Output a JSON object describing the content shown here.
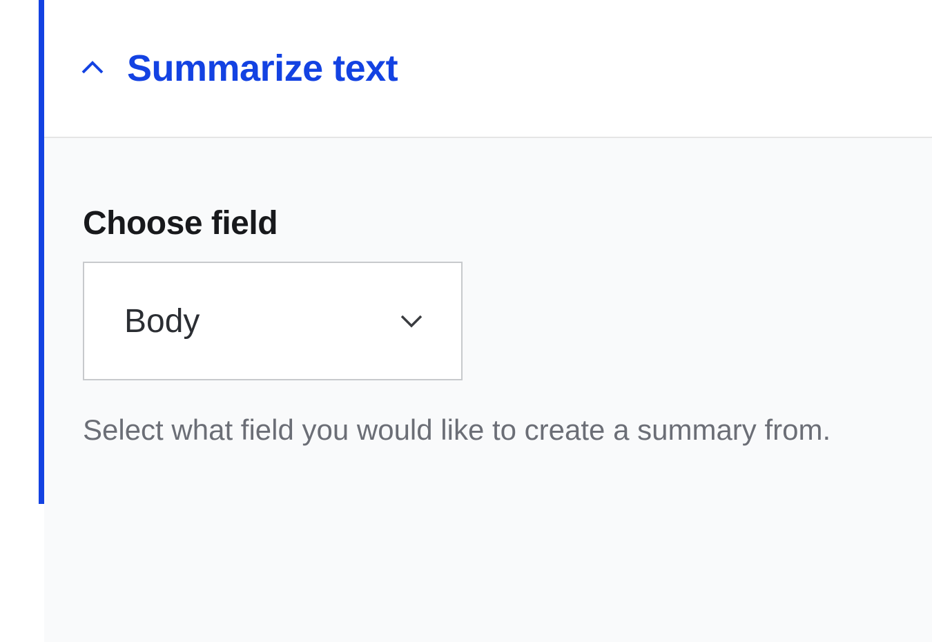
{
  "header": {
    "title": "Summarize text"
  },
  "form": {
    "field_label": "Choose field",
    "select_value": "Body",
    "help_text": "Select what field you would like to create a summary from."
  },
  "colors": {
    "accent": "#1342e2",
    "body_bg": "#f9fafb",
    "text_primary": "#18191c",
    "text_muted": "#6b6e76",
    "border": "#c7c9cc"
  }
}
